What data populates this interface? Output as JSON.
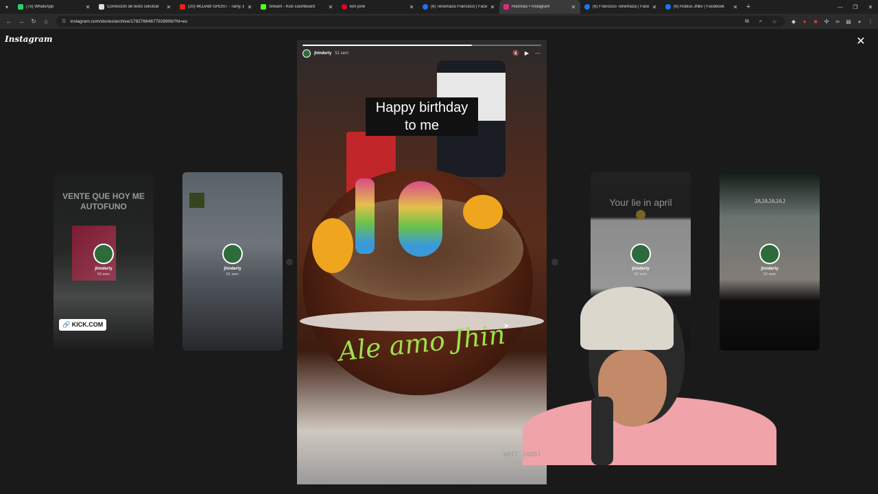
{
  "browser": {
    "tabs": [
      {
        "label": "(75) WhatsApp",
        "color": "#25d366",
        "active": false
      },
      {
        "label": "Corrección de texto solicitud",
        "color": "#dddddd",
        "active": false
      },
      {
        "label": "(20) MOJABI GHOST - Tainy, Ba",
        "color": "#e62117",
        "active": false
      },
      {
        "label": "Stream - Kick Dashboard",
        "color": "#53fc18",
        "active": false
      },
      {
        "label": "kim pine",
        "color": "#e60023",
        "active": false
      },
      {
        "label": "(6) Tenemaza Francisco | Faceb",
        "color": "#1877f2",
        "active": false
      },
      {
        "label": "Historias • Instagram",
        "color": "#dd2a7b",
        "active": true
      },
      {
        "label": "(6) Francisco Tenemaza | Faceb",
        "color": "#1877f2",
        "active": false
      },
      {
        "label": "(6) Rubius JhBv | Facebook",
        "color": "#1877f2",
        "active": false
      }
    ],
    "new_tab": "+",
    "url": "instagram.com/stories/archive/17927664677928906/?hl=es"
  },
  "viewer": {
    "logo": "Instagram",
    "close": "✕",
    "main_story": {
      "username": "jhinderty",
      "time": "51 sem",
      "progress": 0.71,
      "caption": "Happy birthday to me",
      "cake_writing": "Ale amo Jhin"
    },
    "side_stories": [
      {
        "text": "VENTE QUE HOY ME AUTOFUNO",
        "username": "jhinderty",
        "time": "50 sem",
        "sticker": "🔗 KICK.COM"
      },
      {
        "text": "",
        "username": "jhinderty",
        "time": "51 sem"
      },
      {
        "text": "Your lie in april",
        "username": "jhinderty",
        "time": "52 sem"
      },
      {
        "text": "JAJAJAJAJ",
        "username": "jhinderty",
        "time": "52 sem"
      }
    ],
    "cam_caption": "WAIT JADDJ"
  },
  "colors": {
    "background": "#1a1a1a",
    "cake_writing": "#9be24a"
  }
}
